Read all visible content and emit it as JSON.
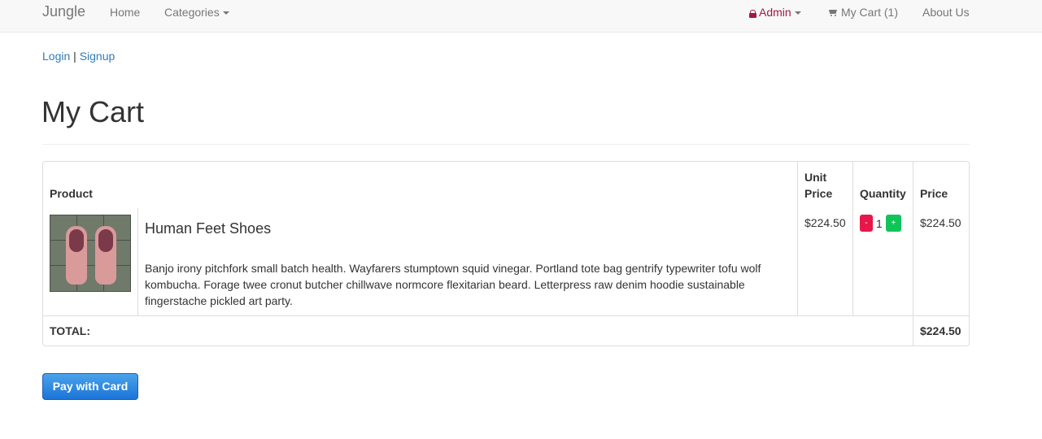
{
  "navbar": {
    "brand": "Jungle",
    "home": "Home",
    "categories": "Categories",
    "admin": "Admin",
    "cart": "My Cart (1)",
    "about": "About Us",
    "admin_color": "#a0174a"
  },
  "auth": {
    "login": "Login",
    "separator": "|",
    "signup": "Signup"
  },
  "page": {
    "title": "My Cart"
  },
  "table": {
    "headers": {
      "product": "Product",
      "unit_price": "Unit Price",
      "quantity": "Quantity",
      "price": "Price"
    },
    "items": [
      {
        "name": "Human Feet Shoes",
        "description": "Banjo irony pitchfork small batch health. Wayfarers stumptown squid vinegar. Portland tote bag gentrify typewriter tofu wolf kombucha. Forage twee cronut butcher chillwave normcore flexitarian beard. Letterpress raw denim hoodie sustainable fingerstache pickled art party.",
        "unit_price": "$224.50",
        "qty_minus": "-",
        "quantity": "1",
        "qty_plus": "+",
        "price": "$224.50"
      }
    ],
    "total_label": "TOTAL:",
    "total_value": "$224.50"
  },
  "checkout": {
    "pay_label": "Pay with Card"
  },
  "colors": {
    "link": "#337ab7",
    "minus_button": "#e8174a",
    "plus_button": "#10c458",
    "pay_button": "#1b74d8"
  }
}
